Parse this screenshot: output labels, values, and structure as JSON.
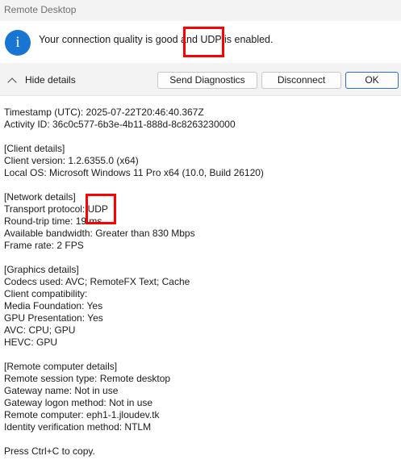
{
  "window": {
    "title": "Remote Desktop"
  },
  "info": {
    "icon": "info-icon",
    "icon_glyph": "i",
    "message": "Your connection quality is good and UDP is enabled."
  },
  "actions": {
    "toggle_label": "Hide details",
    "diagnostics_label": "Send Diagnostics",
    "disconnect_label": "Disconnect",
    "ok_label": "OK"
  },
  "details": {
    "lines": [
      "Timestamp (UTC): 2025-07-22T20:46:40.367Z",
      "Activity ID: 36c0c577-6b3e-4b11-888d-8c8263230000",
      "[Client details]",
      "Client version: 1.2.6355.0 (x64)",
      "Local OS: Microsoft Windows 11 Pro x64 (10.0, Build 26120)",
      "[Network details]",
      "Transport protocol: UDP",
      "Round-trip time: 19 ms",
      "Available bandwidth: Greater than 830 Mbps",
      "Frame rate: 2 FPS",
      "[Graphics details]",
      "Codecs used: AVC; RemoteFX Text; Cache",
      "Client compatibility:",
      "Media Foundation: Yes",
      "GPU Presentation: Yes",
      "AVC: CPU; GPU",
      "HEVC: GPU",
      "[Remote computer details]",
      "Remote session type: Remote desktop",
      "Gateway name: Not in use",
      "Gateway logon method: Not in use",
      "Remote computer: eph1-1.jloudev.tk",
      "Identity verification method: NTLM",
      "Press Ctrl+C to copy."
    ]
  },
  "colors": {
    "accent": "#1875d1",
    "highlight": "#ff0000",
    "bar_background": "#f3f3f3"
  }
}
